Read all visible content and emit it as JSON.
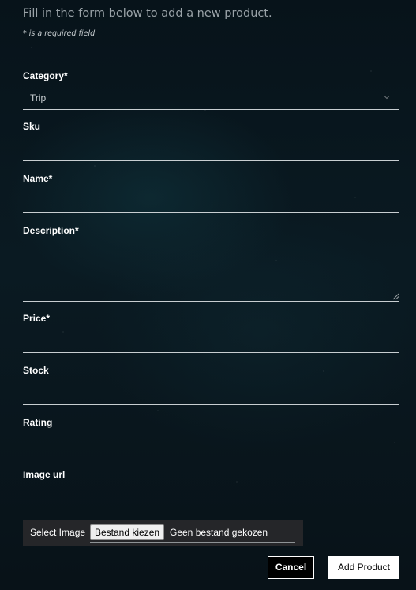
{
  "form": {
    "intro_text": "Fill in the form below to add a new product.",
    "required_note": "* is a required field",
    "fields": {
      "category": {
        "label": "Category*",
        "value": "Trip"
      },
      "sku": {
        "label": "Sku",
        "value": ""
      },
      "name": {
        "label": "Name*",
        "value": ""
      },
      "description": {
        "label": "Description*",
        "value": ""
      },
      "price": {
        "label": "Price*",
        "value": ""
      },
      "stock": {
        "label": "Stock",
        "value": ""
      },
      "rating": {
        "label": "Rating",
        "value": ""
      },
      "image_url": {
        "label": "Image url",
        "value": ""
      }
    },
    "image_upload": {
      "label": "Select Image",
      "button_label": "Bestand kiezen",
      "status_text": "Geen bestand gekozen"
    },
    "actions": {
      "cancel_label": "Cancel",
      "submit_label": "Add Product"
    }
  },
  "icons": {
    "select_arrow": "chevron-down-icon",
    "textarea_resize": "resize-handle-icon"
  },
  "colors": {
    "background": "#07131a",
    "text": "#ffffff",
    "muted_text": "#9aa3a8",
    "input_underline": "#c8ced1",
    "submit_button_bg": "#ffffff",
    "cancel_button_bg": "#000000"
  }
}
